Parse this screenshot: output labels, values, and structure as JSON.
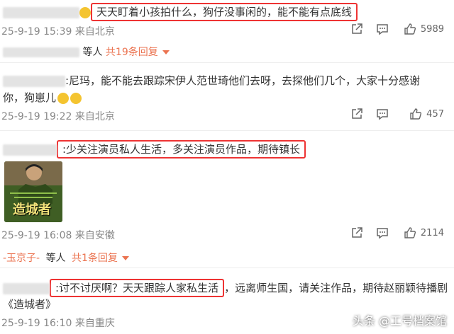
{
  "comments": [
    {
      "user_blur": "xxxxxxxxxxxxx",
      "prefix": ":",
      "text": "天天盯着小孩拍什么，狗仔没事闲的，能不能有点底线",
      "time": "25-9-19 15:39",
      "location": "来自北京",
      "likes": "5989",
      "replies": {
        "users_blur": "xxxxxxxxx",
        "others": "等人",
        "count_label": "共19条回复"
      }
    },
    {
      "user_blur": "xxxxxxxxxx",
      "text_line1": ":尼玛，能不能去跟踪宋伊人范世琦他们去呀，去探他们几个，大家十分感谢",
      "text_line2": "你，狗崽儿",
      "time": "25-9-19 19:22",
      "location": "来自北京",
      "likes": "457"
    },
    {
      "user_blur": "xxxxxxx",
      "text": ":少关注演员私人生活，多关注演员作品，期待镇长",
      "image_caption": "造城者",
      "time": "25-9-19 16:08",
      "location": "来自安徽",
      "likes": "2114",
      "replies": {
        "user": "-玉京子-",
        "others": "等人",
        "count_label": "共1条回复"
      }
    },
    {
      "user_blur": "xxxxxxx",
      "boxed_text": ":讨不讨厌啊？天天跟踪人家私生活",
      "rest_text": "，远离师生国，请关注作品，期待赵丽颖待播剧",
      "text_line2": "《造城者》",
      "time": "25-9-19 16:10",
      "location": "来自重庆"
    }
  ],
  "watermark": "头条 @工号档案馆",
  "icons": [
    "share-icon",
    "comment-icon",
    "like-icon",
    "emoji-icon"
  ],
  "colors": {
    "highlight_box": "#e33333",
    "reply_link": "#eb7350",
    "meta_text": "#888888"
  }
}
